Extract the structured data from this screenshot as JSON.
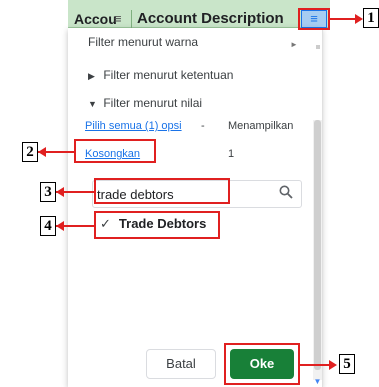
{
  "sheet": {
    "col_a_label": "Accou",
    "col_b_label": "Account Description"
  },
  "filter_panel": {
    "filter_by_color": "Filter menurut warna",
    "filter_by_condition": "Filter menurut ketentuan",
    "filter_by_value": "Filter menurut nilai",
    "select_all": "Pilih semua (1) opsi",
    "select_all_dash": "-",
    "showing_label": "Menampilkan",
    "clear_link": "Kosongkan",
    "showing_count": "1",
    "search_value": "trade debtors",
    "result_item": "Trade Debtors",
    "cancel_label": "Batal",
    "ok_label": "Oke"
  },
  "annotations": {
    "n1": "1",
    "n2": "2",
    "n3": "3",
    "n4": "4",
    "n5": "5"
  },
  "colors": {
    "header_green": "#c9e5c9",
    "annotation_red": "#e02020",
    "ok_green": "#188038",
    "link_blue": "#1a73e8"
  }
}
